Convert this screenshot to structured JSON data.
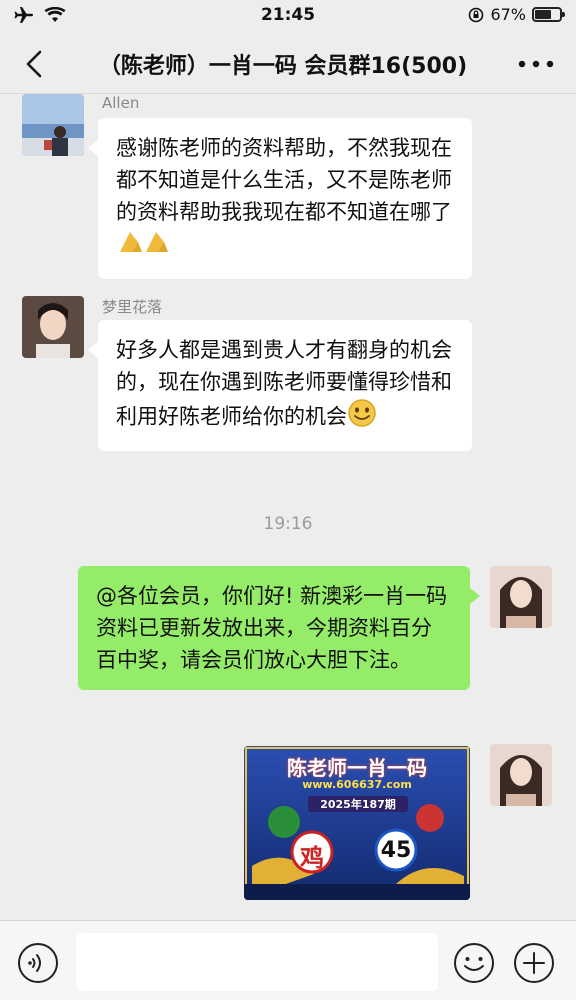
{
  "status_bar": {
    "time": "21:45",
    "battery": "67%",
    "battery_level": 0.67
  },
  "nav": {
    "title": "（陈老师）一肖一码 会员群16(500)"
  },
  "messages": [
    {
      "sender": "Allen",
      "text": "感谢陈老师的资料帮助，不然我现在都不知道是什么生活，又不是陈老师的资料帮助我我现在都不知道在哪了"
    },
    {
      "sender": "梦里花落",
      "text": "好多人都是遇到贵人才有翻身的机会的，现在你遇到陈老师要懂得珍惜和利用好陈老师给你的机会"
    },
    {
      "time": "19:16"
    },
    {
      "text": "@各位会员，你们好! 新澳彩一肖一码资料已更新发放出来，今期资料百分百中奖，请会员们放心大胆下注。"
    }
  ],
  "promo_image": {
    "headline": "陈老师一肖一码",
    "url": "www.606637.com",
    "period": "2025年187期",
    "zodiac": "鸡",
    "number": "45"
  },
  "icons": [
    "back-chevron-icon",
    "more-dots-icon",
    "voice-icon",
    "emoji-icon",
    "plus-icon",
    "airplane-icon",
    "wifi-icon",
    "lock-rotation-icon",
    "battery-icon"
  ]
}
